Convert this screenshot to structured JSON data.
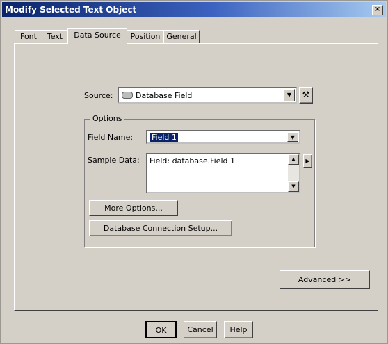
{
  "window": {
    "title": "Modify Selected Text Object",
    "close_glyph": "×"
  },
  "tabs": [
    {
      "label": "Font"
    },
    {
      "label": "Text"
    },
    {
      "label": "Data Source",
      "active": true
    },
    {
      "label": "Position"
    },
    {
      "label": "General"
    }
  ],
  "source": {
    "label": "Source:",
    "value": "Database Field"
  },
  "options": {
    "legend": "Options",
    "field_name_label": "Field Name:",
    "field_name_value": "Field 1",
    "sample_data_label": "Sample Data:",
    "sample_data_value": "Field: database.Field 1"
  },
  "buttons": {
    "more_options": "More Options...",
    "db_setup": "Database Connection Setup...",
    "advanced": "Advanced >>",
    "ok": "OK",
    "cancel": "Cancel",
    "help": "Help"
  }
}
